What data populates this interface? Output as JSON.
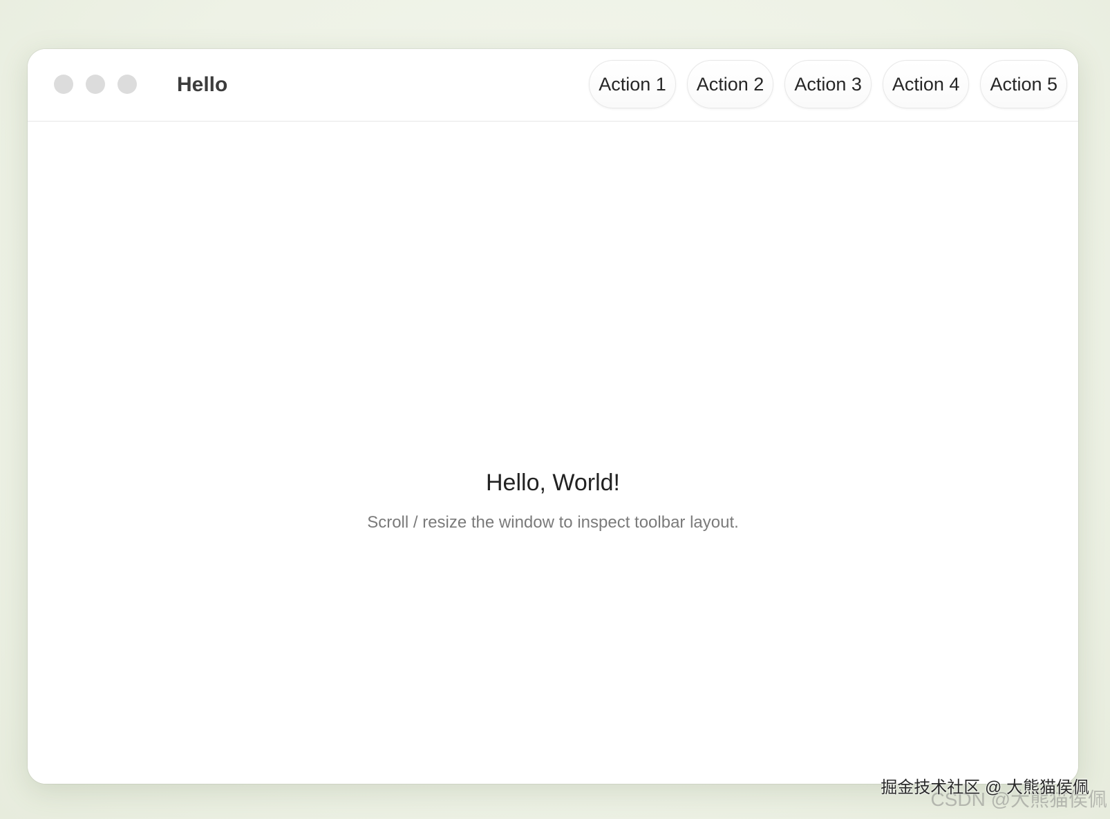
{
  "window": {
    "title": "Hello",
    "traffic_lights": [
      "close",
      "minimize",
      "zoom"
    ]
  },
  "toolbar": {
    "actions": [
      {
        "label": "Action 1"
      },
      {
        "label": "Action 2"
      },
      {
        "label": "Action 3"
      },
      {
        "label": "Action 4"
      },
      {
        "label": "Action 5"
      }
    ]
  },
  "content": {
    "headline": "Hello, World!",
    "subline": "Scroll / resize the window to inspect toolbar layout."
  },
  "watermarks": {
    "primary": "掘金技术社区 @ 大熊猫侯佩",
    "secondary": "CSDN @大熊猫侯佩"
  },
  "colors": {
    "traffic_light": "#dcdcdc",
    "background": "#eef2e6"
  }
}
